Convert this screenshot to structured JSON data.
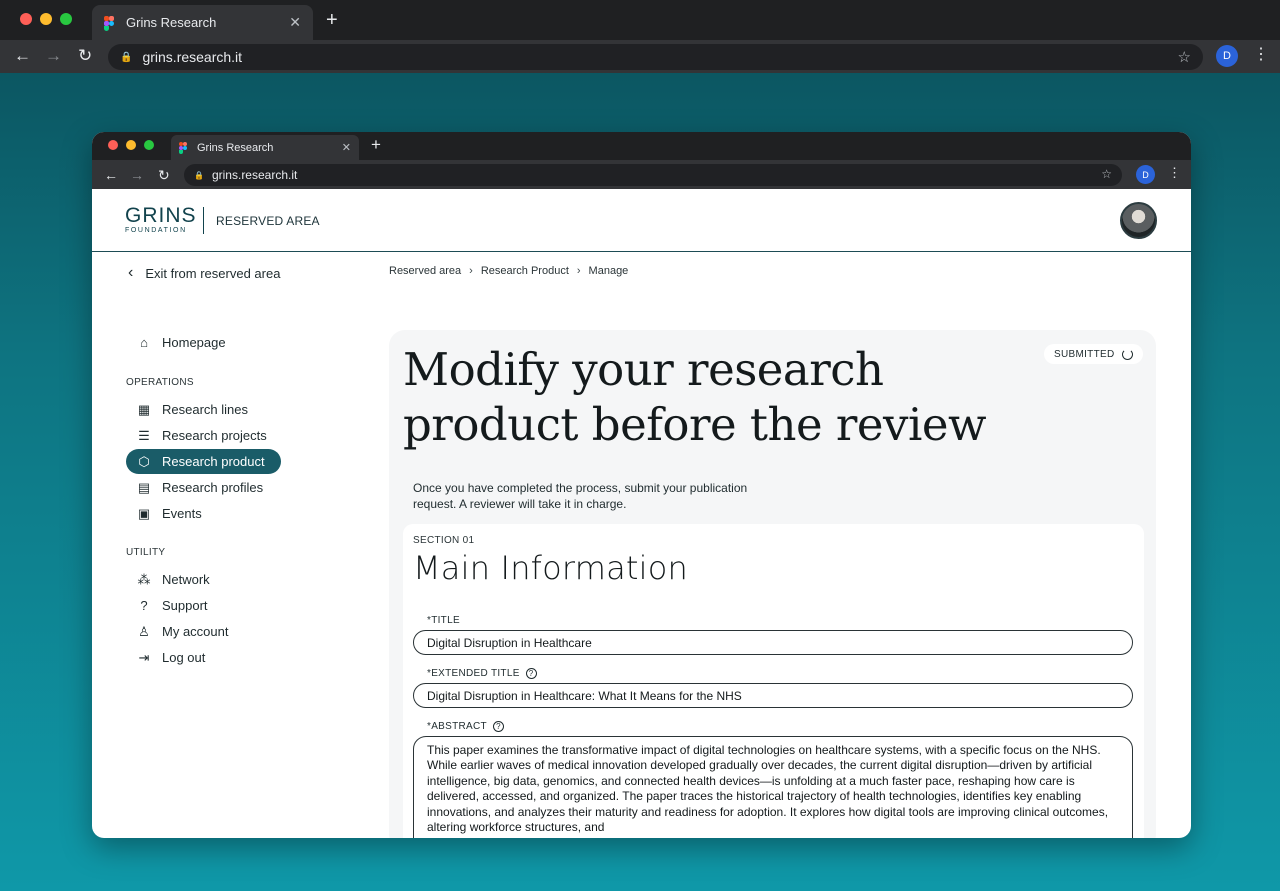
{
  "browser": {
    "tab_title": "Grins Research",
    "url": "grins.research.it",
    "profile_initial": "D"
  },
  "inner_browser": {
    "tab_title": "Grins Research",
    "url": "grins.research.it",
    "profile_initial": "D"
  },
  "header": {
    "logo_main": "GRINS",
    "logo_sub": "FOUNDATION",
    "area_label": "RESERVED AREA"
  },
  "subnav": {
    "exit_label": "Exit from reserved area",
    "breadcrumb": [
      "Reserved area",
      "Research Product",
      "Manage"
    ]
  },
  "sidebar": {
    "home": {
      "label": "Homepage",
      "icon": "home-icon"
    },
    "operations_heading": "OPERATIONS",
    "operations": [
      {
        "label": "Research lines",
        "icon": "building-icon"
      },
      {
        "label": "Research projects",
        "icon": "database-icon"
      },
      {
        "label": "Research product",
        "icon": "cube-icon",
        "active": true
      },
      {
        "label": "Research profiles",
        "icon": "profile-list-icon"
      },
      {
        "label": "Events",
        "icon": "calendar-icon"
      }
    ],
    "utility_heading": "UTILITY",
    "utility": [
      {
        "label": "Network",
        "icon": "network-icon"
      },
      {
        "label": "Support",
        "icon": "question-icon"
      },
      {
        "label": "My account",
        "icon": "user-icon"
      },
      {
        "label": "Log out",
        "icon": "logout-icon"
      }
    ]
  },
  "main": {
    "status": "SUBMITTED",
    "title": "Modify your research product before the review",
    "intro": "Once you have completed the process, submit your publication request. A reviewer will take it in charge.",
    "section_label": "SECTION 01",
    "section_title": "Main Information",
    "fields": {
      "title_label": "*TITLE",
      "title_value": "Digital Disruption in Healthcare",
      "extended_label": "*EXTENDED TITLE",
      "extended_value": "Digital Disruption in Healthcare: What It Means for the NHS",
      "abstract_label": "*ABSTRACT",
      "abstract_value": "This paper examines the transformative impact of digital technologies on healthcare systems, with a specific focus on the NHS. While earlier waves of medical innovation developed gradually over decades, the current digital disruption—driven by artificial intelligence, big data, genomics, and connected health devices—is unfolding at a much faster pace, reshaping how care is delivered, accessed, and organized. The paper traces the historical trajectory of health technologies, identifies key enabling innovations, and analyzes their maturity and readiness for adoption. It explores how digital tools are improving clinical outcomes, altering workforce structures, and"
    }
  },
  "colors": {
    "accent": "#1a5c68",
    "brand": "#12434d",
    "background_gradient_top": "#0b4f5a",
    "background_gradient_bottom": "#0f98a8"
  }
}
